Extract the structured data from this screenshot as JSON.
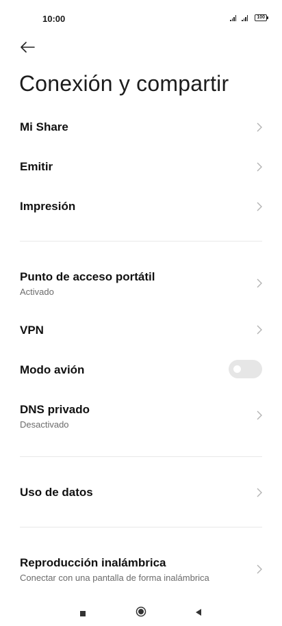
{
  "status_bar": {
    "time": "10:00",
    "battery": "100"
  },
  "header": {
    "title": "Conexión y compartir"
  },
  "sections": {
    "group1": [
      {
        "label": "Mi Share"
      },
      {
        "label": "Emitir"
      },
      {
        "label": "Impresión"
      }
    ],
    "group2": [
      {
        "label": "Punto de acceso portátil",
        "sub": "Activado"
      },
      {
        "label": "VPN"
      },
      {
        "label": "Modo avión",
        "toggle": false
      },
      {
        "label": "DNS privado",
        "sub": "Desactivado"
      }
    ],
    "group3": [
      {
        "label": "Uso de datos"
      }
    ],
    "group4": [
      {
        "label": "Reproducción inalámbrica",
        "sub": "Conectar con una pantalla de forma inalámbrica"
      }
    ]
  },
  "icons": {
    "back": "arrow-left-icon",
    "chevron": "chevron-right-icon"
  },
  "colors": {
    "background": "#ffffff",
    "divider": "#e8e8e8",
    "toggle_off": "#e6e6e6"
  }
}
